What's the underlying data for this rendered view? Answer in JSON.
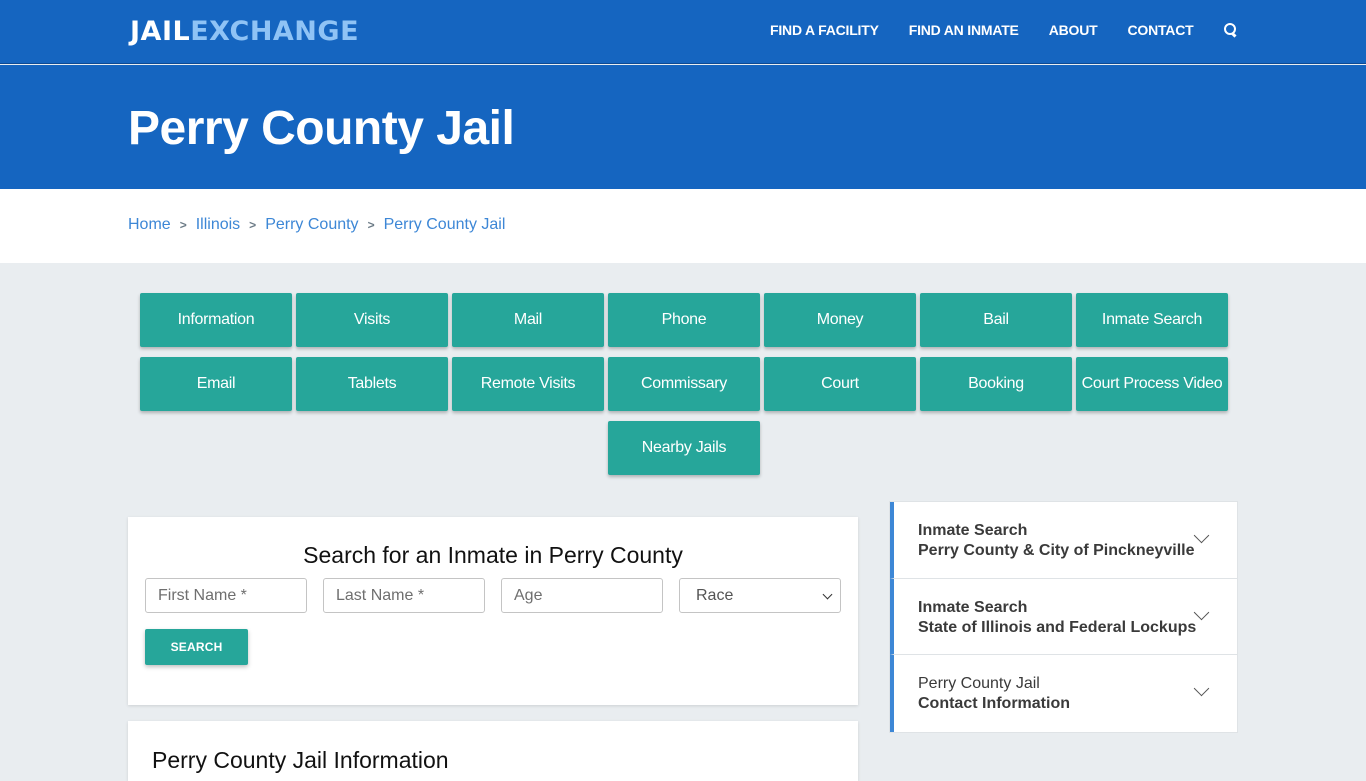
{
  "header": {
    "logo_part1": "JAIL",
    "logo_part2": "EXCHANGE",
    "nav": [
      "FIND A FACILITY",
      "FIND AN INMATE",
      "ABOUT",
      "CONTACT"
    ],
    "search_icon": "search-icon"
  },
  "colors": {
    "primary_blue": "#1565c0",
    "logo_accent": "#8fc3f5",
    "teal": "#26a69a",
    "link_blue": "#3d87d6",
    "page_bg": "#e9edf0"
  },
  "hero": {
    "title": "Perry County Jail"
  },
  "breadcrumb": [
    "Home",
    "Illinois",
    "Perry County",
    "Perry County Jail"
  ],
  "tiles": [
    "Information",
    "Visits",
    "Mail",
    "Phone",
    "Money",
    "Bail",
    "Inmate Search",
    "Email",
    "Tablets",
    "Remote Visits",
    "Commissary",
    "Court",
    "Booking",
    "Court Process Video",
    "Nearby Jails"
  ],
  "search": {
    "title": "Search for an Inmate in Perry County",
    "first_name_placeholder": "First Name *",
    "last_name_placeholder": "Last Name *",
    "age_placeholder": "Age",
    "race_selected": "Race",
    "button": "SEARCH"
  },
  "info": {
    "title": "Perry County Jail Information"
  },
  "accordion": [
    {
      "line1": "Inmate Search",
      "line2": "Perry County & City of Pinckneyville",
      "line1_bold": true
    },
    {
      "line1": "Inmate Search",
      "line2": "State of Illinois and Federal Lockups",
      "line1_bold": true
    },
    {
      "line1": "Perry County Jail",
      "line2": "Contact Information",
      "line1_bold": false
    }
  ]
}
